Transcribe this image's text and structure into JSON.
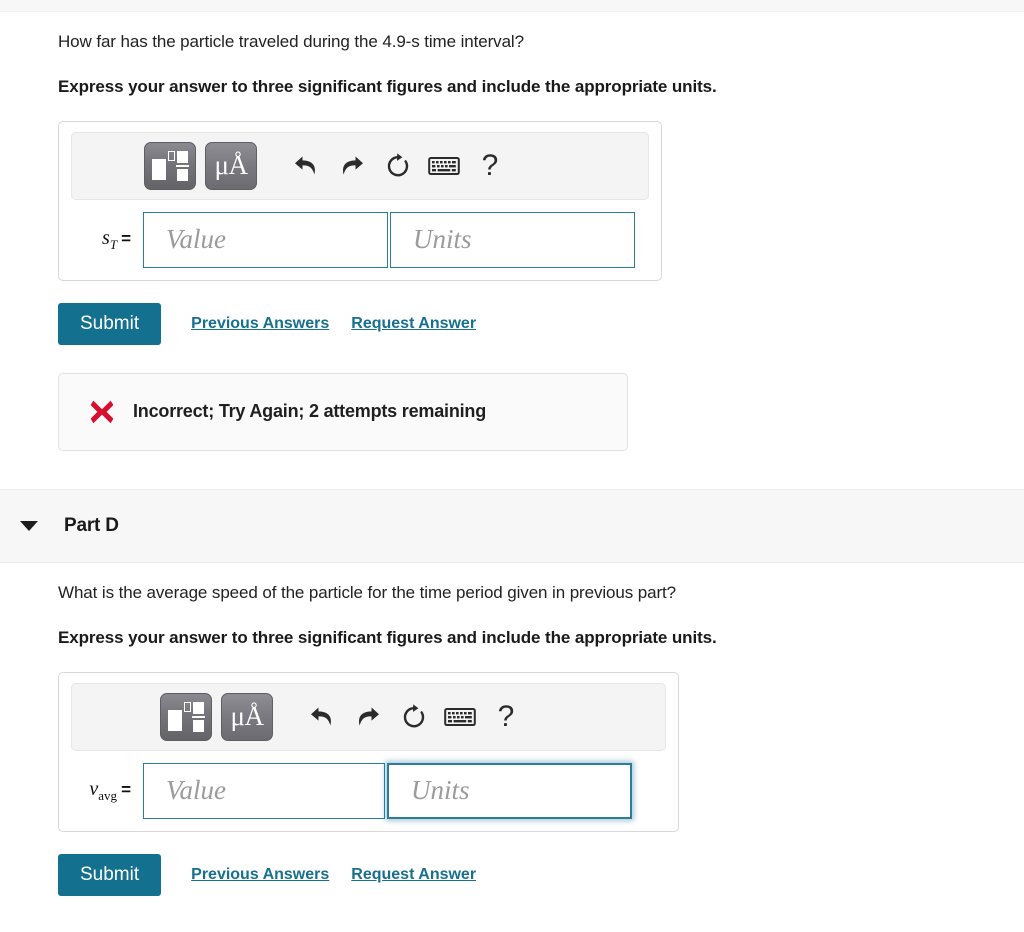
{
  "parts": [
    {
      "id": "part-c",
      "question": "How far has the particle traveled during the 4.9-s time interval?",
      "instruction": "Express your answer to three significant figures and include the appropriate units.",
      "toolbar": {
        "template_icon": "math-template-icon",
        "units_icon": "units-micro-angstrom-icon",
        "units_label": "μÅ",
        "undo_icon": "undo-icon",
        "redo_icon": "redo-icon",
        "reset_icon": "reset-icon",
        "keyboard_icon": "keyboard-icon",
        "help_icon": "help-icon",
        "help_label": "?"
      },
      "answer": {
        "variable": "s",
        "subscript": "T",
        "subscript_style": "italic",
        "equals": "=",
        "value_placeholder": "Value",
        "value": "",
        "units_placeholder": "Units",
        "units": "",
        "value_focused": false,
        "units_focused": false
      },
      "actions": {
        "submit_label": "Submit",
        "previous_answers_label": "Previous Answers",
        "request_answer_label": "Request Answer"
      },
      "feedback": {
        "visible": true,
        "icon": "incorrect-x-icon",
        "text": "Incorrect; Try Again; 2 attempts remaining"
      }
    },
    {
      "id": "part-d",
      "header": {
        "caret_icon": "chevron-down-icon",
        "title": "Part D"
      },
      "question": "What is the average speed of the particle for the time period given in previous part?",
      "instruction": "Express your answer to three significant figures and include the appropriate units.",
      "toolbar": {
        "template_icon": "math-template-icon",
        "units_icon": "units-micro-angstrom-icon",
        "units_label": "μÅ",
        "undo_icon": "undo-icon",
        "redo_icon": "redo-icon",
        "reset_icon": "reset-icon",
        "keyboard_icon": "keyboard-icon",
        "help_icon": "help-icon",
        "help_label": "?"
      },
      "answer": {
        "variable": "v",
        "subscript": "avg",
        "subscript_style": "roman",
        "equals": "=",
        "value_placeholder": "Value",
        "value": "",
        "units_placeholder": "Units",
        "units": "",
        "value_focused": false,
        "units_focused": true
      },
      "actions": {
        "submit_label": "Submit",
        "previous_answers_label": "Previous Answers",
        "request_answer_label": "Request Answer"
      },
      "feedback": {
        "visible": false,
        "icon": "",
        "text": ""
      }
    }
  ],
  "colors": {
    "accent_teal": "#14708f",
    "link_teal": "#17708e",
    "field_border": "#2b7d9b",
    "error_red": "#d60f2e",
    "band_bg": "#f7f7f7"
  }
}
